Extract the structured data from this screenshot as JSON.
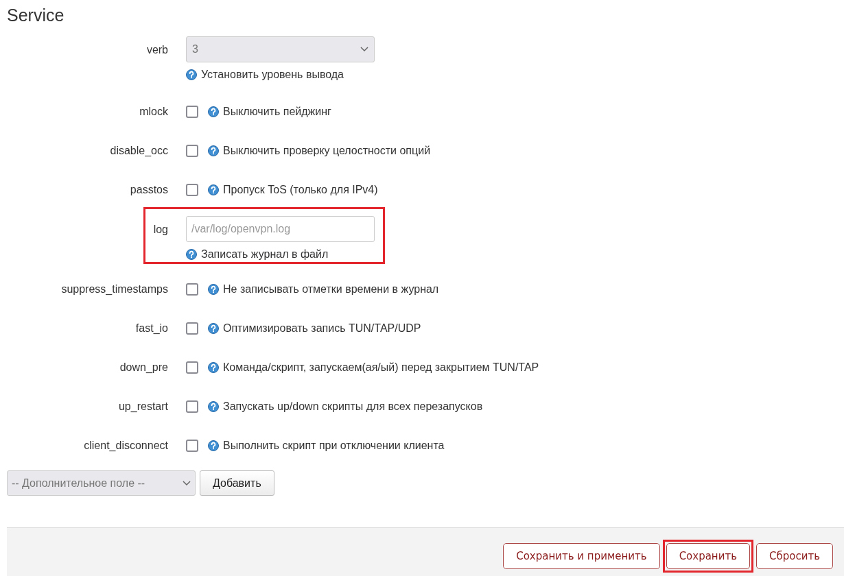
{
  "title": "Service",
  "options": [
    {
      "kind": "select",
      "label": "verb",
      "value": "3",
      "help": "Установить уровень вывода",
      "highlighted": false
    },
    {
      "kind": "checkbox",
      "label": "mlock",
      "checked": false,
      "help": "Выключить пейджинг",
      "highlighted": false
    },
    {
      "kind": "checkbox",
      "label": "disable_occ",
      "checked": false,
      "help": "Выключить проверку целостности опций",
      "highlighted": false
    },
    {
      "kind": "checkbox",
      "label": "passtos",
      "checked": false,
      "help": "Пропуск ToS (только для IPv4)",
      "highlighted": false
    },
    {
      "kind": "text",
      "label": "log",
      "placeholder": "/var/log/openvpn.log",
      "help": "Записать журнал в файл",
      "highlighted": true
    },
    {
      "kind": "checkbox",
      "label": "suppress_timestamps",
      "checked": false,
      "help": "Не записывать отметки времени в журнал",
      "highlighted": false
    },
    {
      "kind": "checkbox",
      "label": "fast_io",
      "checked": false,
      "help": "Оптимизировать запись TUN/TAP/UDP",
      "highlighted": false
    },
    {
      "kind": "checkbox",
      "label": "down_pre",
      "checked": false,
      "help": "Команда/скрипт, запускаем(ая/ый) перед закрытием TUN/TAP",
      "highlighted": false
    },
    {
      "kind": "checkbox",
      "label": "up_restart",
      "checked": false,
      "help": "Запускать up/down скрипты для всех перезапусков",
      "highlighted": false
    },
    {
      "kind": "checkbox",
      "label": "client_disconnect",
      "checked": false,
      "help": "Выполнить скрипт при отключении клиента",
      "highlighted": false
    }
  ],
  "add_field": {
    "select": "-- Дополнительное поле --",
    "button": "Добавить"
  },
  "footer_buttons": [
    {
      "label": "Сохранить и применить",
      "highlighted": false
    },
    {
      "label": "Сохранить",
      "highlighted": true
    },
    {
      "label": "Сбросить",
      "highlighted": false
    }
  ]
}
